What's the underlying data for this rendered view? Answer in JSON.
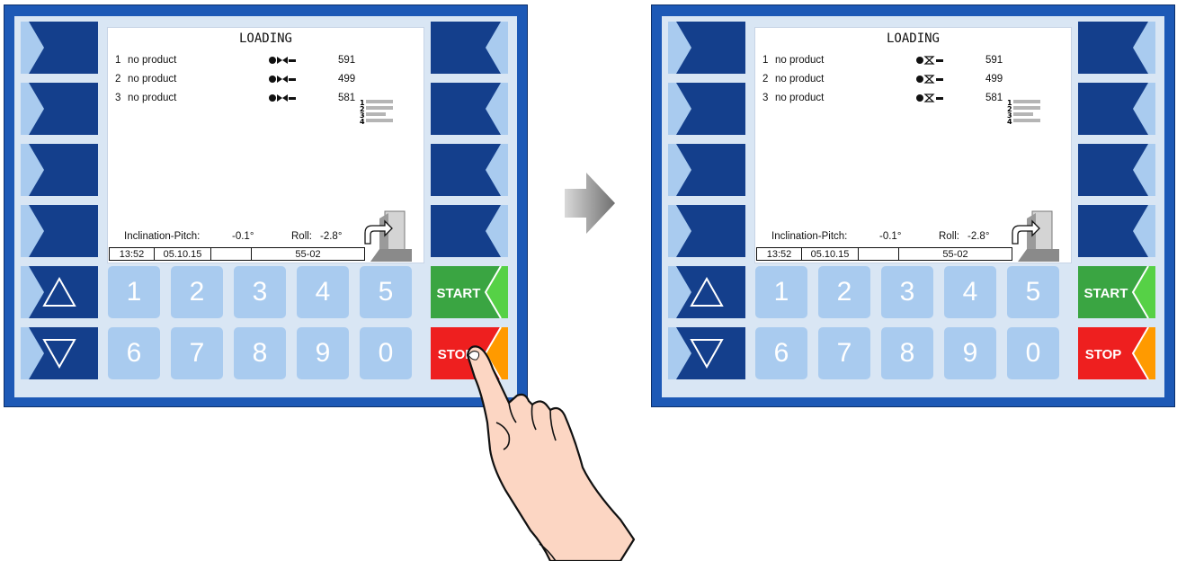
{
  "panels": [
    {
      "screen": {
        "title": "LOADING",
        "rows": [
          {
            "no": "1",
            "product": "no product",
            "value": "591"
          },
          {
            "no": "2",
            "product": "no product",
            "value": "499"
          },
          {
            "no": "3",
            "product": "no product",
            "value": "581"
          }
        ],
        "row_icon": "valve-closed-icon",
        "compartment_levels": [
          "1",
          "2",
          "3",
          "4"
        ],
        "inclination_label": "Inclination-Pitch:",
        "inclination_value": "-0.1°",
        "roll_label": "Roll:",
        "roll_value": "-2.8°",
        "status": {
          "time": "13:52",
          "date": "05.10.15",
          "empty": "",
          "code": "55-02"
        }
      },
      "keypad": {
        "row1": [
          "1",
          "2",
          "3",
          "4",
          "5"
        ],
        "row2": [
          "6",
          "7",
          "8",
          "9",
          "0"
        ]
      },
      "start_label": "START",
      "stop_label": "STOP"
    },
    {
      "screen": {
        "title": "LOADING",
        "rows": [
          {
            "no": "1",
            "product": "no product",
            "value": "591"
          },
          {
            "no": "2",
            "product": "no product",
            "value": "499"
          },
          {
            "no": "3",
            "product": "no product",
            "value": "581"
          }
        ],
        "row_icon": "hourglass-icon",
        "compartment_levels": [
          "1",
          "2",
          "3",
          "4"
        ],
        "inclination_label": "Inclination-Pitch:",
        "inclination_value": "-0.1°",
        "roll_label": "Roll:",
        "roll_value": "-2.8°",
        "status": {
          "time": "13:52",
          "date": "05.10.15",
          "empty": "",
          "code": "55-02"
        }
      },
      "keypad": {
        "row1": [
          "1",
          "2",
          "3",
          "4",
          "5"
        ],
        "row2": [
          "6",
          "7",
          "8",
          "9",
          "0"
        ]
      },
      "start_label": "START",
      "stop_label": "STOP"
    }
  ],
  "colors": {
    "frame": "#1d59b6",
    "softkey_dark": "#143f8c",
    "softkey_light": "#a9cbef",
    "start_green": "#3aa542",
    "start_green_light": "#56d146",
    "stop_red": "#ee1f1f",
    "stop_orange": "#ff9a00"
  },
  "transition_icon": "arrow-right-icon",
  "pointer": "finger-pointing-icon"
}
